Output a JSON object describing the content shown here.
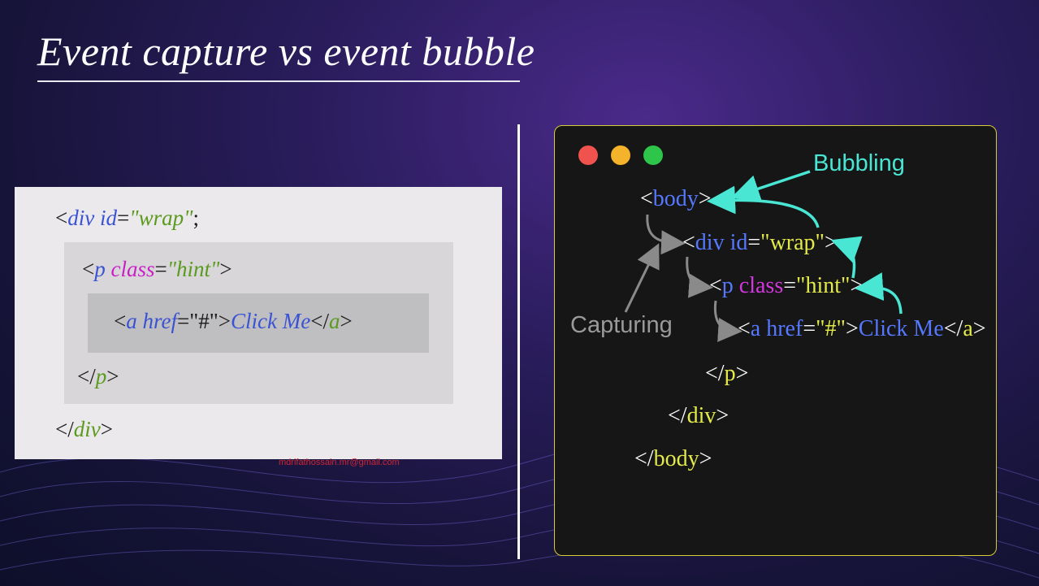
{
  "title": "Event capture vs event bubble",
  "left_code": {
    "line1": {
      "lt": "<",
      "tag": "div",
      "attr": " id",
      "eq": "=",
      "val": "\"wrap\"",
      "end": ";"
    },
    "line2": {
      "lt": "<",
      "tag": "p",
      "attr": " class",
      "eq": "=",
      "val": "\"hint\"",
      "end": ">"
    },
    "line3": {
      "lt": "<",
      "tag": "a",
      "attr": " href",
      "eq": "=",
      "val": "\"#\"",
      "gt": ">",
      "text": "Click Me",
      "close_lt": "</",
      "close_tag": "a",
      "close_gt": ">"
    },
    "line4": {
      "lt": "</",
      "tag": "p",
      "end": ">"
    },
    "line5": {
      "lt": "</",
      "tag": "div",
      "end": ">"
    }
  },
  "watermark": "mdrifathossain.mr@gmail.com",
  "window": {
    "dots": [
      "red",
      "yellow",
      "green"
    ],
    "label_bubbling": "Bubbling",
    "label_capturing": "Capturing",
    "lines": {
      "body_open": {
        "lt": "<",
        "tag": "body",
        "gt": ">"
      },
      "div_open": {
        "lt": "<",
        "tag": "div",
        "attr": " id",
        "eq": "=",
        "val": "\"wrap\"",
        "gt": ">"
      },
      "p_open": {
        "lt": "<",
        "tag": "p",
        "attr": " class",
        "eq": "=",
        "val": "\"hint\"",
        "gt": ">"
      },
      "a_line": {
        "lt": "<",
        "tag": "a",
        "attr": " href",
        "eq": "=",
        "val": "\"#\"",
        "gt": ">",
        "text": "Click Me",
        "close_lt": "</",
        "close_tag": "a",
        "close_gt": ">"
      },
      "p_close": {
        "lt": "</",
        "tag": "p",
        "gt": ">"
      },
      "div_close": {
        "lt": "</",
        "tag": "div",
        "gt": ">"
      },
      "body_close": {
        "lt": "</",
        "tag": "body",
        "gt": ">"
      }
    }
  },
  "colors": {
    "tag_blue": "#5578ff",
    "attr_magenta": "#d536e0",
    "value_yellow": "#e3ea4a",
    "bubbling_cyan": "#49e6d4",
    "capturing_gray": "#9a9a9a",
    "window_border": "#d6cb3a"
  }
}
